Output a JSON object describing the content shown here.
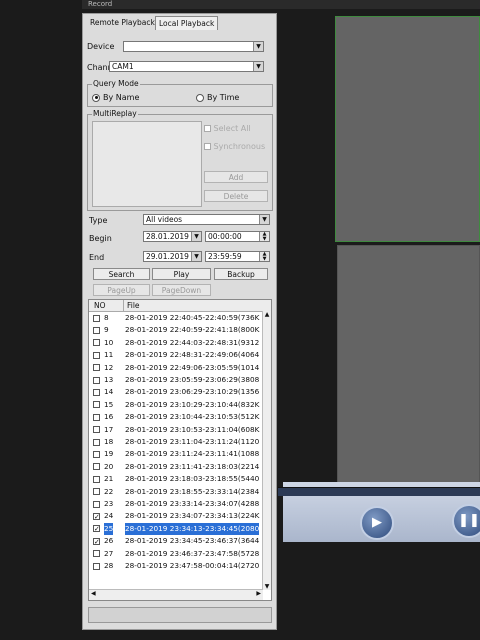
{
  "window": {
    "title": "Record"
  },
  "tabs": [
    {
      "label": "Remote Playback",
      "active": false
    },
    {
      "label": "Local Playback",
      "active": true
    }
  ],
  "device": {
    "label": "Device",
    "value": ""
  },
  "channel": {
    "label": "Channel",
    "value": "CAM1"
  },
  "query_mode": {
    "title": "Query Mode",
    "by_name": "By Name",
    "by_time": "By Time",
    "selected": "By Name"
  },
  "multireplay": {
    "title": "MultiReplay",
    "select_all": "Select All",
    "synchronous": "Synchronous",
    "add": "Add",
    "delete": "Delete"
  },
  "filter": {
    "type_label": "Type",
    "type_value": "All videos",
    "begin_label": "Begin",
    "begin_date": "28.01.2019",
    "begin_time": "00:00:00",
    "end_label": "End",
    "end_date": "29.01.2019",
    "end_time": "23:59:59"
  },
  "buttons": {
    "search": "Search",
    "play": "Play",
    "backup": "Backup",
    "page_up": "PageUp",
    "page_down": "PageDown"
  },
  "file_table": {
    "col_no": "NO",
    "col_file": "File",
    "rows": [
      {
        "no": "8",
        "file": "28-01-2019 22:40:45-22:40:59(736K",
        "checked": false
      },
      {
        "no": "9",
        "file": "28-01-2019 22:40:59-22:41:18(800K",
        "checked": false
      },
      {
        "no": "10",
        "file": "28-01-2019 22:44:03-22:48:31(9312",
        "checked": false
      },
      {
        "no": "11",
        "file": "28-01-2019 22:48:31-22:49:06(4064",
        "checked": false
      },
      {
        "no": "12",
        "file": "28-01-2019 22:49:06-23:05:59(1014",
        "checked": false
      },
      {
        "no": "13",
        "file": "28-01-2019 23:05:59-23:06:29(3808",
        "checked": false
      },
      {
        "no": "14",
        "file": "28-01-2019 23:06:29-23:10:29(1356",
        "checked": false
      },
      {
        "no": "15",
        "file": "28-01-2019 23:10:29-23:10:44(832K",
        "checked": false
      },
      {
        "no": "16",
        "file": "28-01-2019 23:10:44-23:10:53(512K",
        "checked": false
      },
      {
        "no": "17",
        "file": "28-01-2019 23:10:53-23:11:04(608K",
        "checked": false
      },
      {
        "no": "18",
        "file": "28-01-2019 23:11:04-23:11:24(1120",
        "checked": false
      },
      {
        "no": "19",
        "file": "28-01-2019 23:11:24-23:11:41(1088",
        "checked": false
      },
      {
        "no": "20",
        "file": "28-01-2019 23:11:41-23:18:03(2214",
        "checked": false
      },
      {
        "no": "21",
        "file": "28-01-2019 23:18:03-23:18:55(5440",
        "checked": false
      },
      {
        "no": "22",
        "file": "28-01-2019 23:18:55-23:33:14(2384",
        "checked": false
      },
      {
        "no": "23",
        "file": "28-01-2019 23:33:14-23:34:07(4288",
        "checked": false
      },
      {
        "no": "24",
        "file": "28-01-2019 23:34:07-23:34:13(224K",
        "checked": true
      },
      {
        "no": "25",
        "file": "28-01-2019 23:34:13-23:34:45(2080",
        "checked": true,
        "selected": true
      },
      {
        "no": "26",
        "file": "28-01-2019 23:34:45-23:46:37(3644",
        "checked": true
      },
      {
        "no": "27",
        "file": "28-01-2019 23:46:37-23:47:58(5728",
        "checked": false
      },
      {
        "no": "28",
        "file": "28-01-2019 23:47:58-00:04:14(2720",
        "checked": false
      }
    ]
  },
  "player": {
    "play_icon": "play-icon",
    "pause_icon": "pause-icon"
  },
  "colors": {
    "selection": "#2a6fd6",
    "video_border": "#3f8a3f",
    "panel": "#dcdcdc"
  }
}
